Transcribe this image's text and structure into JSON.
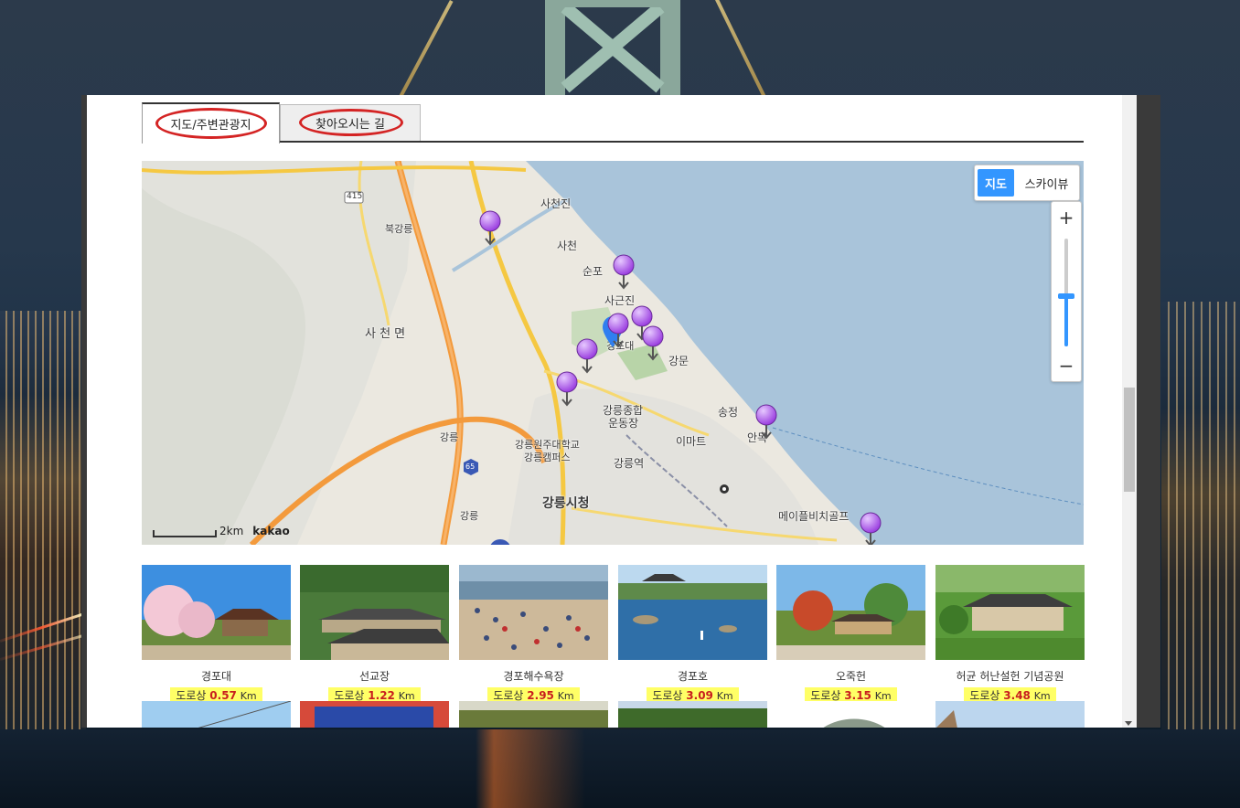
{
  "tabs": [
    {
      "label": "지도/주변관광지",
      "active": true
    },
    {
      "label": "찾아오시는 길",
      "active": false
    }
  ],
  "map": {
    "type_control": {
      "map_label": "지도",
      "skyview_label": "스카이뷰",
      "selected": "지도"
    },
    "zoom": {
      "in_label": "+",
      "out_label": "−"
    },
    "scale_label": "2km",
    "provider_label": "kakao",
    "place_labels": {
      "sacheonjin": "사천진",
      "sacheon": "사천",
      "sunpo": "순포",
      "sageunjin": "사근진",
      "bukgangneung": "북강릉",
      "sacheon_myeon": "사 천 면",
      "gyeongpodae": "경포대",
      "gangmun": "강문",
      "songjeong": "송정",
      "anmok": "안목",
      "stadium_1": "강릉종합",
      "stadium_2": "운동장",
      "univ_1": "강릉원주대학교",
      "univ_2": "강릉캠퍼스",
      "emart": "이마트",
      "station": "강릉역",
      "city_hall": "강릉시청",
      "gangneung_ic": "강릉",
      "gangneung_ic2": "강릉",
      "golf": "메이플비치골프",
      "route_415": "415",
      "route_65": "65"
    }
  },
  "attractions": [
    {
      "name": "경포대",
      "distance_prefix": "도로상",
      "distance_value": "0.57",
      "unit": "Km"
    },
    {
      "name": "선교장",
      "distance_prefix": "도로상",
      "distance_value": "1.22",
      "unit": "Km"
    },
    {
      "name": "경포해수욕장",
      "distance_prefix": "도로상",
      "distance_value": "2.95",
      "unit": "Km"
    },
    {
      "name": "경포호",
      "distance_prefix": "도로상",
      "distance_value": "3.09",
      "unit": "Km"
    },
    {
      "name": "오죽헌",
      "distance_prefix": "도로상",
      "distance_value": "3.15",
      "unit": "Km"
    },
    {
      "name": "허균 허난설헌 기념공원",
      "distance_prefix": "도로상",
      "distance_value": "3.48",
      "unit": "Km"
    }
  ],
  "colors": {
    "annotation_oval": "#d42424",
    "map_button_active": "#3396ff",
    "distance_highlight": "#ffff66",
    "distance_value": "#c81e1e",
    "pin_purple": "#9b3fe0"
  }
}
